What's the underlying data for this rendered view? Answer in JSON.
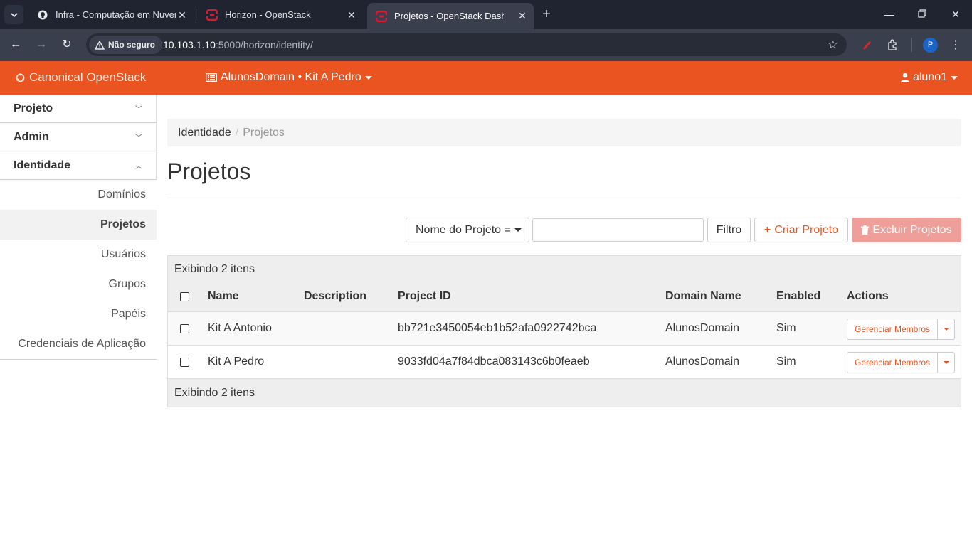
{
  "browser": {
    "tabs": [
      {
        "title": "Infra - Computação em Nuvem",
        "icon": "github-icon"
      },
      {
        "title": "Horizon - OpenStack",
        "icon": "openstack-icon"
      },
      {
        "title": "Projetos - OpenStack Dashboard",
        "icon": "openstack-icon",
        "active": true
      }
    ],
    "security_label": "Não seguro",
    "url_host": "10.103.1.10",
    "url_path": ":5000/horizon/identity/",
    "profile_initial": "P"
  },
  "header": {
    "brand": "Canonical OpenStack",
    "context": "AlunosDomain • Kit A Pedro",
    "user": "aluno1",
    "accent_color": "#e95420"
  },
  "sidebar": {
    "panels": [
      {
        "label": "Projeto"
      },
      {
        "label": "Admin"
      },
      {
        "label": "Identidade"
      }
    ],
    "items": [
      {
        "label": "Domínios"
      },
      {
        "label": "Projetos",
        "active": true
      },
      {
        "label": "Usuários"
      },
      {
        "label": "Grupos"
      },
      {
        "label": "Papéis"
      },
      {
        "label": "Credenciais de Aplicação"
      }
    ]
  },
  "breadcrumb": {
    "parent": "Identidade",
    "current": "Projetos"
  },
  "page": {
    "title": "Projetos"
  },
  "toolbar": {
    "filter_field": "Nome do Projeto =",
    "filter_value": "",
    "filter_button": "Filtro",
    "create_button": "Criar Projeto",
    "delete_button": "Excluir Projetos"
  },
  "table": {
    "caption": "Exibindo 2 itens",
    "footer": "Exibindo 2 itens",
    "columns": [
      "Name",
      "Description",
      "Project ID",
      "Domain Name",
      "Enabled",
      "Actions"
    ],
    "rows": [
      {
        "name": "Kit A Antonio",
        "description": "",
        "project_id": "bb721e3450054eb1b52afa0922742bca",
        "domain": "AlunosDomain",
        "enabled": "Sim",
        "action": "Gerenciar Membros"
      },
      {
        "name": "Kit A Pedro",
        "description": "",
        "project_id": "9033fd04a7f84dbca083143c6b0feaeb",
        "domain": "AlunosDomain",
        "enabled": "Sim",
        "action": "Gerenciar Membros"
      }
    ]
  }
}
